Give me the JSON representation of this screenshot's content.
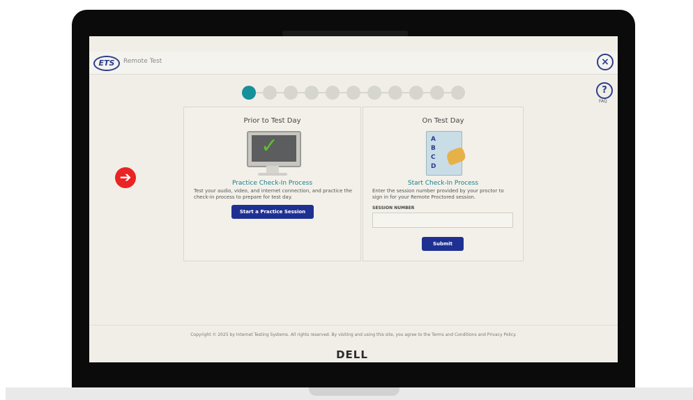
{
  "brand": "DELL",
  "header": {
    "logo": "ETS",
    "title": "Remote Test"
  },
  "close_icon": "×",
  "help": {
    "icon": "?",
    "label": "FAQ"
  },
  "steps": {
    "total": 11,
    "current": 1
  },
  "left_panel": {
    "title": "Prior to Test Day",
    "subtitle": "Practice Check-In Process",
    "text": "Test your audio, video, and internet connection, and practice the check-in process to prepare for test day.",
    "button": "Start a Practice Session"
  },
  "right_panel": {
    "title": "On Test Day",
    "options": [
      "A",
      "B",
      "C",
      "D"
    ],
    "subtitle": "Start Check-In Process",
    "text": "Enter the session number provided by your proctor to sign in for your Remote Proctored session.",
    "field_label": "SESSION NUMBER",
    "field_value": "",
    "button": "Submit"
  },
  "footer": "Copyright © 2025 by Internet Testing Systems. All rights reserved. By visiting and using this site, you agree to the Terms and Conditions and Privacy Policy.",
  "colors": {
    "accent": "#16909a",
    "button": "#1e3192",
    "arrow": "#ea2323"
  }
}
